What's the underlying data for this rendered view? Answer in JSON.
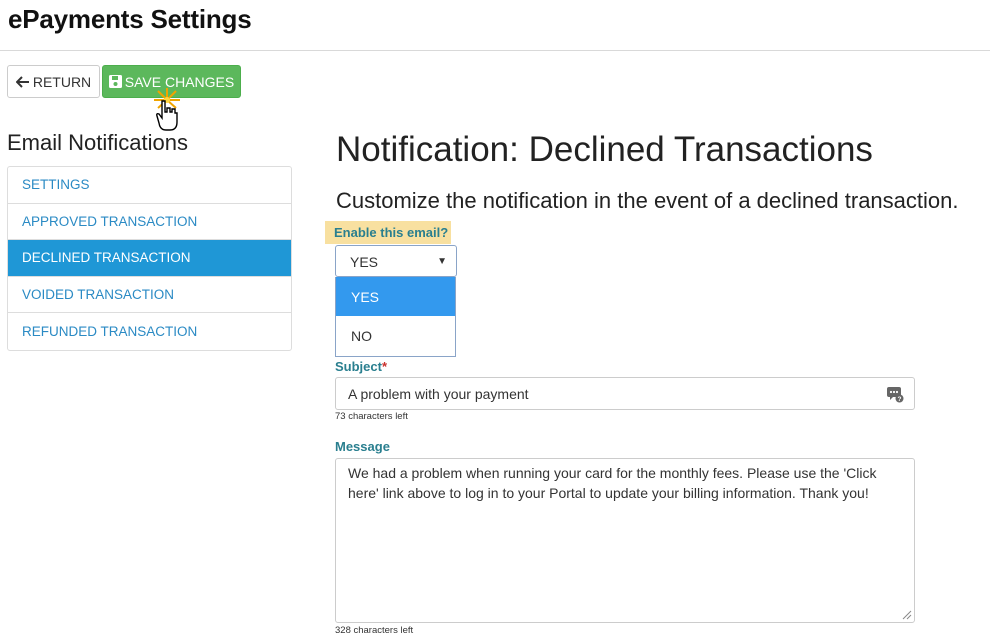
{
  "page": {
    "title": "ePayments Settings"
  },
  "toolbar": {
    "return_label": "RETURN",
    "save_label": "SAVE CHANGES"
  },
  "sidebar": {
    "title": "Email Notifications",
    "items": [
      {
        "label": "SETTINGS"
      },
      {
        "label": "APPROVED TRANSACTION"
      },
      {
        "label": "DECLINED TRANSACTION",
        "active": true
      },
      {
        "label": "VOIDED TRANSACTION"
      },
      {
        "label": "REFUNDED TRANSACTION"
      }
    ]
  },
  "main": {
    "title": "Notification: Declined Transactions",
    "subtitle": "Customize the notification in the event of a declined transaction.",
    "enable": {
      "label": "Enable this email?",
      "value": "YES",
      "options": [
        "YES",
        "NO"
      ]
    },
    "subject": {
      "label": "Subject",
      "required_mark": "*",
      "value": "A problem with your payment",
      "chars_left": "73 characters left"
    },
    "message": {
      "label": "Message",
      "value": "We had a problem when running your card for the monthly fees. Please use the 'Click here' link above to log in to your Portal to update your billing information. Thank you!",
      "chars_left": "328 characters left"
    }
  },
  "colors": {
    "save_button": "#5cb85c",
    "active_item": "#1f97d6",
    "link": "#2a8ac4",
    "highlight_label": "#f8e0a0",
    "dropdown_selected": "#3399ee"
  },
  "icons": [
    "arrow-left-icon",
    "floppy-disk-icon",
    "hand-pointer-cursor-icon",
    "token-icon",
    "chevron-down-icon",
    "resize-grip-icon"
  ]
}
